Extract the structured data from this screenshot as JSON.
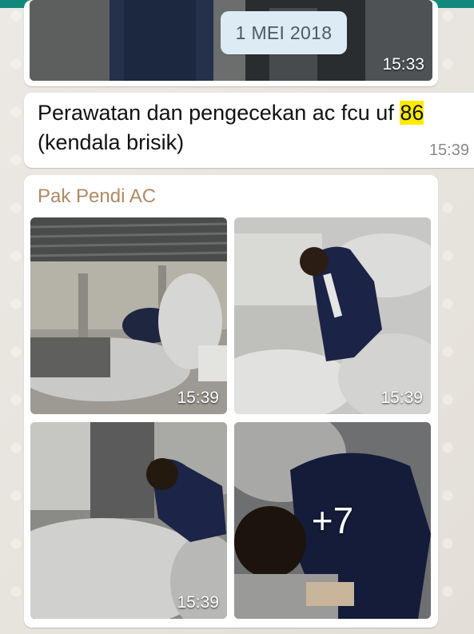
{
  "date_chip": "1 MEI 2018",
  "top_image": {
    "time": "15:33"
  },
  "text_message": {
    "text_before": "Perawatan dan pengecekan ac fcu uf ",
    "highlight": "86",
    "text_after": " (kendala brisik)",
    "time": "15:39"
  },
  "album": {
    "sender": "Pak Pendi AC",
    "photos": [
      {
        "time": "15:39"
      },
      {
        "time": "15:39"
      },
      {
        "time": "15:39"
      },
      {
        "more_count": "+7"
      }
    ]
  },
  "colors": {
    "header": "#0f8a7a",
    "sender_name": "#b08a64",
    "highlight": "#ffeb00",
    "date_chip_bg": "#dcebf4"
  }
}
